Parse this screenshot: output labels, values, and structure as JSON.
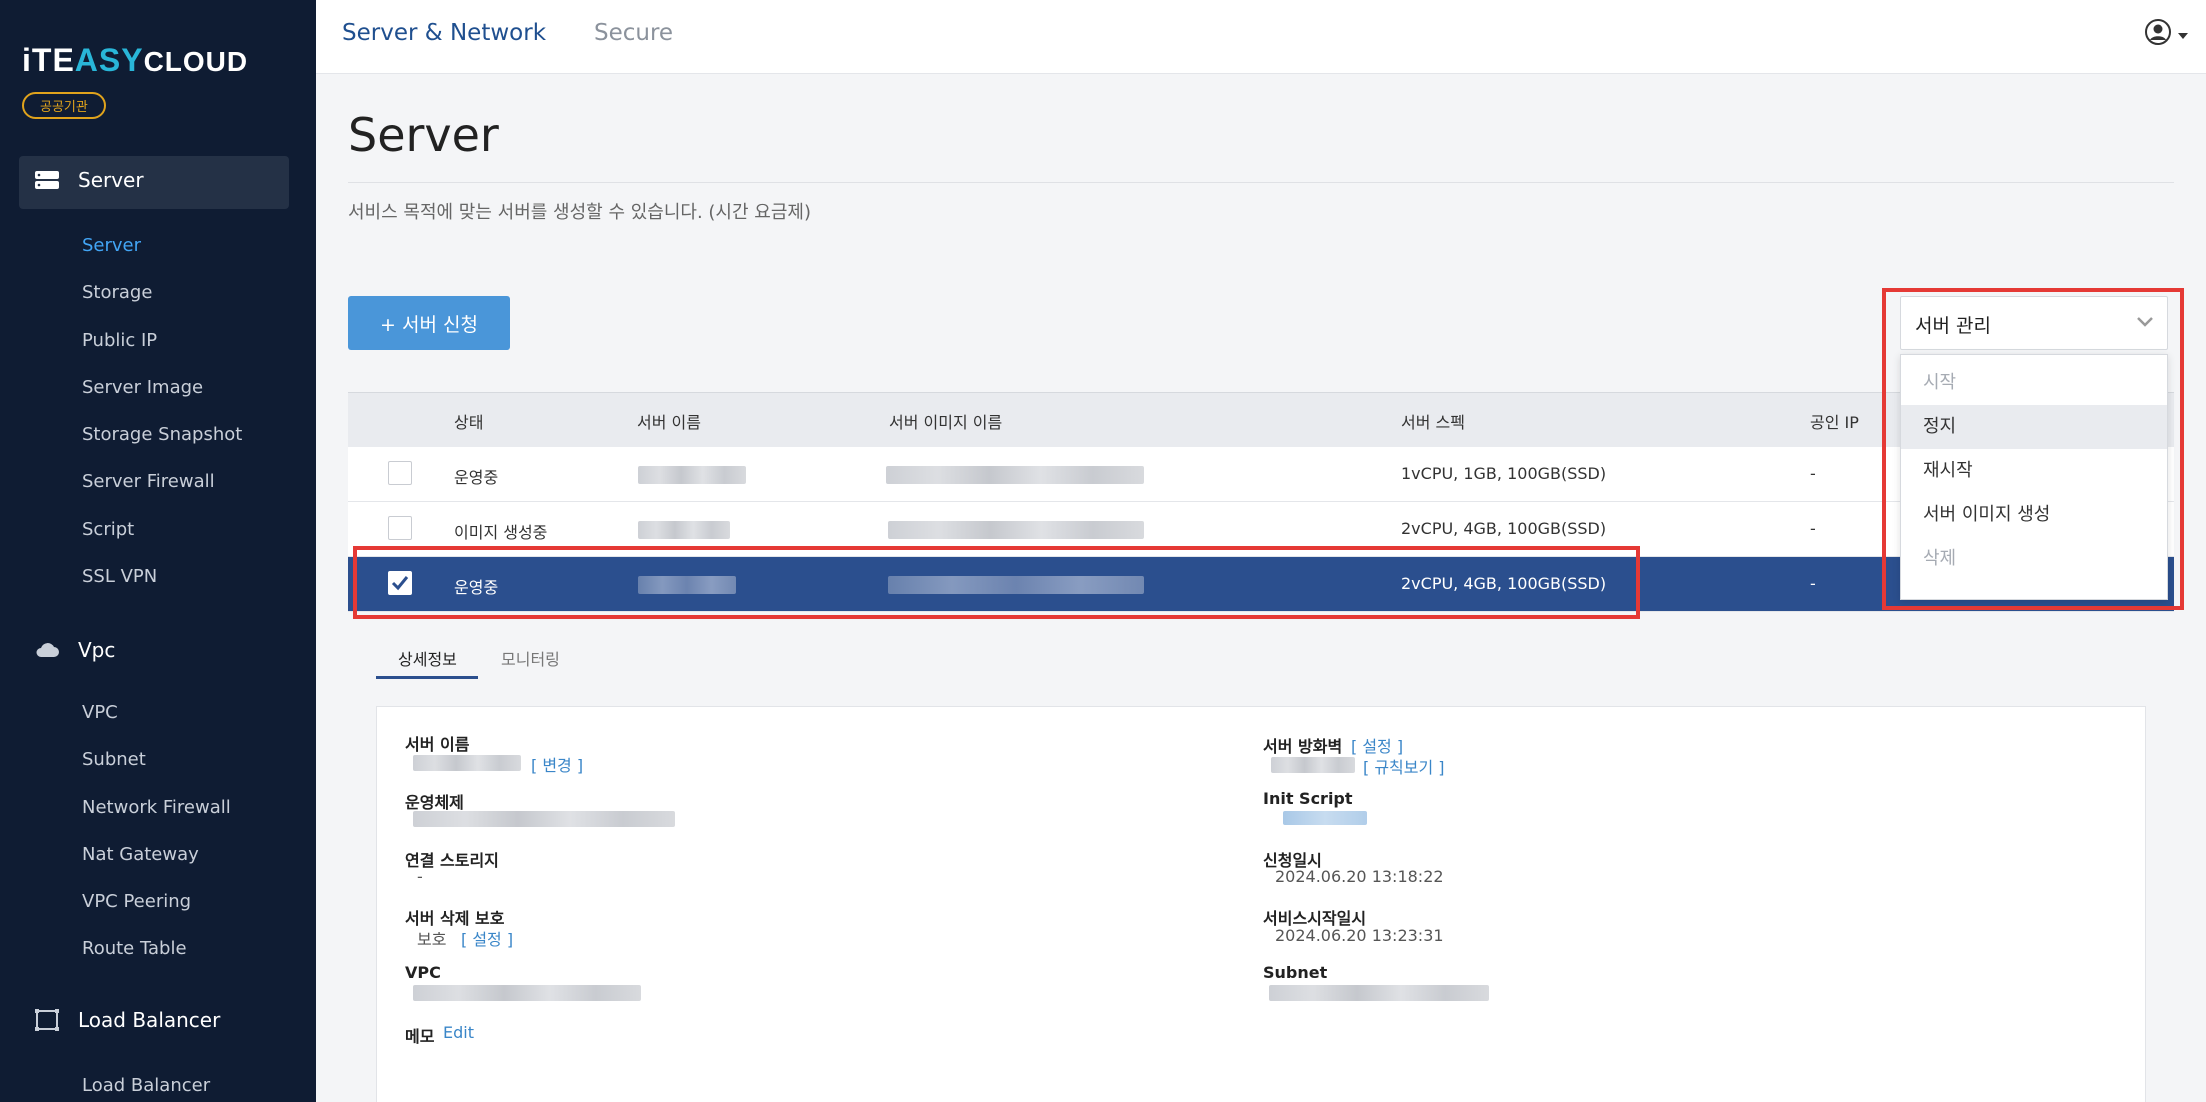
{
  "logo": {
    "part1": "iTE",
    "part2": "ASY",
    "part3": "CLOUD",
    "badge": "공공기관"
  },
  "sidebar": {
    "server_group": "Server",
    "server_items": [
      "Server",
      "Storage",
      "Public IP",
      "Server Image",
      "Storage Snapshot",
      "Server Firewall",
      "Script",
      "SSL VPN"
    ],
    "vpc_group": "Vpc",
    "vpc_items": [
      "VPC",
      "Subnet",
      "Network Firewall",
      "Nat Gateway",
      "VPC Peering",
      "Route Table"
    ],
    "lb_group": "Load Balancer",
    "lb_items": [
      "Load Balancer"
    ]
  },
  "topbar": {
    "tabs": [
      "Server & Network",
      "Secure"
    ]
  },
  "page": {
    "title": "Server",
    "description": "서비스 목적에 맞는 서버를 생성할 수 있습니다. (시간 요금제)",
    "apply_button": "+ 서버 신청"
  },
  "table": {
    "headers": [
      "상태",
      "서버 이름",
      "서버 이미지 이름",
      "서버 스펙",
      "공인 IP"
    ],
    "rows": [
      {
        "status": "운영중",
        "spec": "1vCPU, 1GB, 100GB(SSD)",
        "public_ip": "-"
      },
      {
        "status": "이미지 생성중",
        "spec": "2vCPU, 4GB, 100GB(SSD)",
        "public_ip": "-"
      },
      {
        "status": "운영중",
        "spec": "2vCPU, 4GB, 100GB(SSD)",
        "public_ip": "-"
      }
    ]
  },
  "manage": {
    "selected": "서버 관리",
    "options": [
      "시작",
      "정지",
      "재시작",
      "서버 이미지 생성",
      "삭제"
    ]
  },
  "detail": {
    "tabs": [
      "상세정보",
      "모니터링"
    ],
    "server_name_label": "서버 이름",
    "change_link": "[ 변경 ]",
    "os_label": "운영체제",
    "storage_label": "연결 스토리지",
    "storage_value": "-",
    "delete_protect_label": "서버 삭제 보호",
    "delete_protect_value": "보호",
    "setting_link": "[ 설정 ]",
    "vpc_label": "VPC",
    "memo_label": "메모",
    "memo_edit": "Edit",
    "firewall_label": "서버 방화벽",
    "firewall_setting": "[ 설정 ]",
    "rules_link": "[ 규칙보기 ]",
    "init_script_label": "Init Script",
    "apply_date_label": "신청일시",
    "apply_date": "2024.06.20 13:18:22",
    "start_date_label": "서비스시작일시",
    "start_date": "2024.06.20 13:23:31",
    "subnet_label": "Subnet"
  },
  "colors": {
    "sidebar_bg": "#0f1c33",
    "accent": "#42a5f5",
    "selected_row": "#2b4f8e",
    "highlight": "#e53935"
  }
}
